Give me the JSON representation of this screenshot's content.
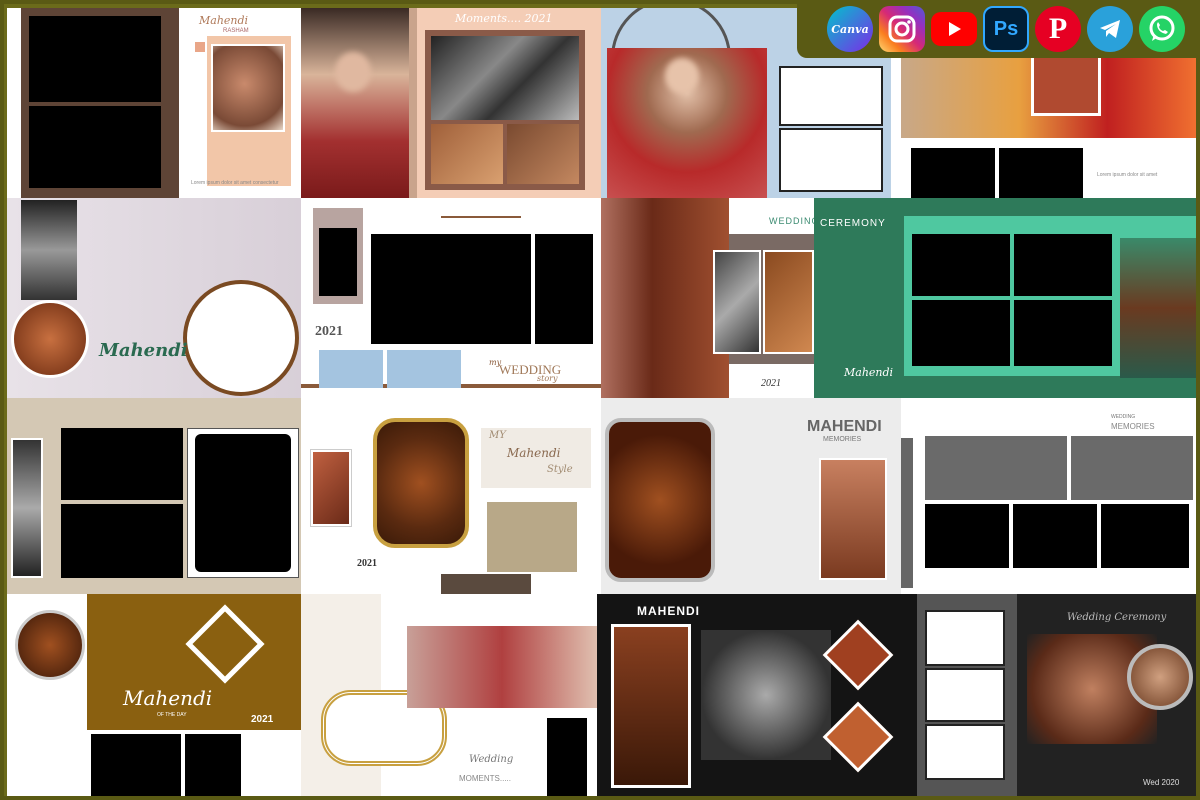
{
  "social": {
    "canva": "Canva",
    "photoshop": "Ps",
    "icons": [
      "canva-icon",
      "instagram-icon",
      "youtube-icon",
      "photoshop-icon",
      "pinterest-icon",
      "telegram-icon",
      "whatsapp-icon"
    ],
    "colors": {
      "canva": "#1fb8cf",
      "instagram": "#d6249f",
      "youtube": "#ff0000",
      "photoshop": "#001e36",
      "pinterest": "#e60023",
      "telegram": "#2aa1da",
      "whatsapp": "#25d366"
    }
  },
  "row1": {
    "p2_title": "Mahendi",
    "p2_sub": "RASHAM",
    "p3_title": "Moments.... 2021"
  },
  "row2": {
    "p1_title": "Mahendi",
    "p2_year": "2021",
    "p2_my": "my",
    "p2_wedding": "WEDDING",
    "p2_story": "story",
    "p3_wedding": "WEDDING",
    "p3_ceremony": "CEREMONY",
    "p3_year": "2021",
    "p3_mahendi": "Mahendi"
  },
  "row3": {
    "p2_my": "MY",
    "p2_mahendi": "Mahendi",
    "p2_style": "Style",
    "p2_year": "2021",
    "p3_title": "MAHENDI",
    "p3_sub": "MEMORIES",
    "p3_wedding": "WEDDING",
    "p3_memories": "MEMORIES"
  },
  "row4": {
    "p1_title": "Mahendi",
    "p1_sub": "OF THE DAY",
    "p1_year": "2021",
    "p2_wedding": "Wedding",
    "p2_moments": "MOMENTS.....",
    "p3_title": "MAHENDI",
    "p4_title": "Wedding Ceremony",
    "p4_date": "Wed 2020"
  }
}
